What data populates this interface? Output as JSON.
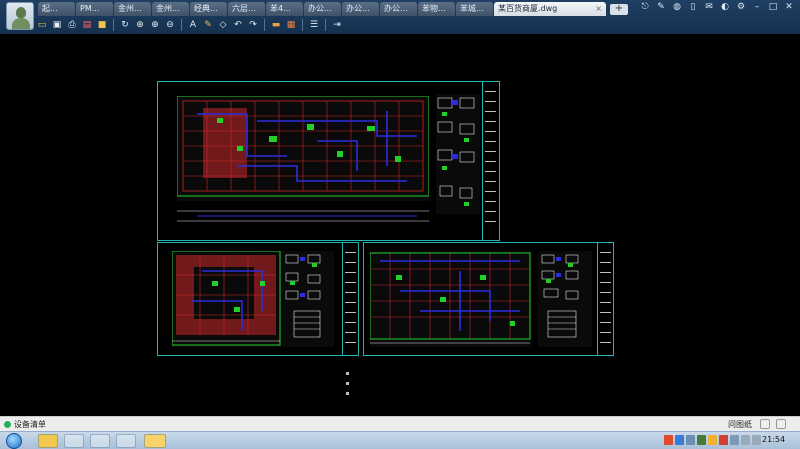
{
  "window": {
    "tabs": [
      {
        "label": "起..."
      },
      {
        "label": "PM..."
      },
      {
        "label": "金州..."
      },
      {
        "label": "金州..."
      },
      {
        "label": "经典..."
      },
      {
        "label": "六层..."
      },
      {
        "label": "苯4..."
      },
      {
        "label": "办公..."
      },
      {
        "label": "办公..."
      },
      {
        "label": "办公..."
      },
      {
        "label": "苯物..."
      },
      {
        "label": "苯城..."
      }
    ],
    "active_tab": "某百货商厦.dwg",
    "add_tab": "+",
    "controls": [
      "share-icon",
      "edit-icon",
      "wechat-icon",
      "phone-icon",
      "mail-icon",
      "skin-icon",
      "gear-icon",
      "minimize-icon",
      "maximize-icon",
      "close-icon"
    ]
  },
  "toolbar": {
    "icons": [
      "open-icon",
      "save-icon",
      "print-icon",
      "pdf-icon",
      "lock-icon",
      "rotate-icon",
      "zoom-fit-icon",
      "zoom-in-icon",
      "zoom-out-icon",
      "text-icon",
      "pen-icon",
      "eraser-icon",
      "undo-icon",
      "redo-icon",
      "measure-icon",
      "hatch-icon",
      "layer-icon",
      "export-icon"
    ]
  },
  "status": {
    "equipment_list": "设备清单",
    "ask": "问图纸"
  },
  "taskbar": {
    "clock": "21:54"
  },
  "colors": {
    "sheet_border": "#1fb5b5",
    "grid_red": "#c8282a",
    "wall_blue": "#2d2de0",
    "green": "#22d02a",
    "white": "#e6e6e6"
  }
}
